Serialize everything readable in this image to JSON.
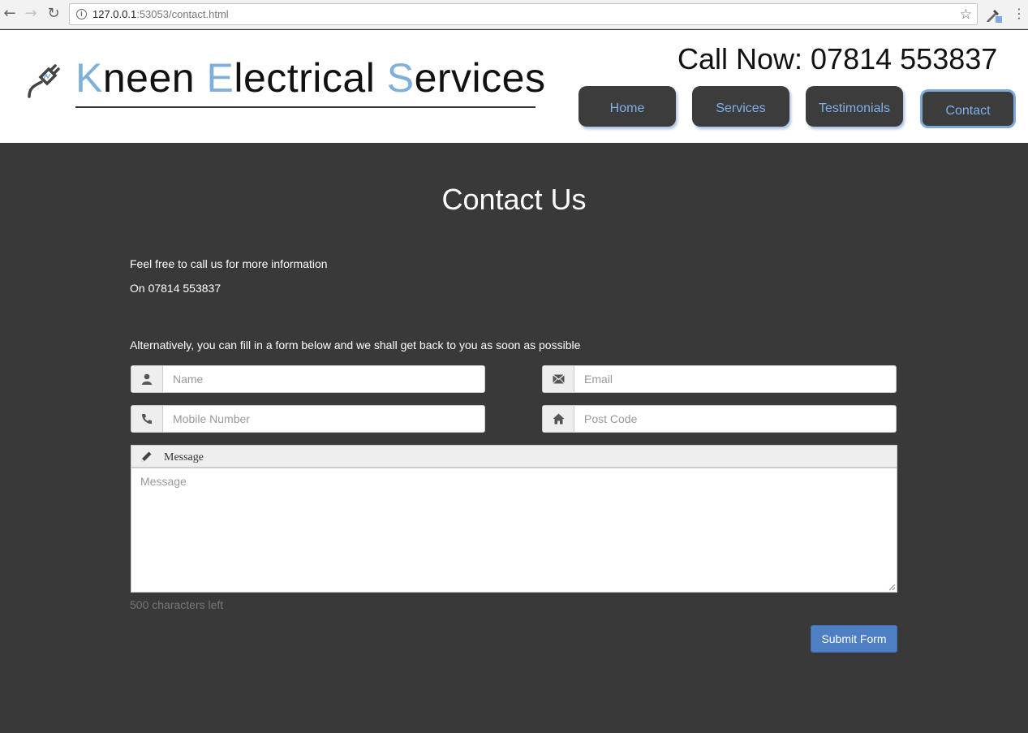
{
  "browser": {
    "url_host": "127.0.0.1",
    "url_rest": ":53053/contact.html"
  },
  "header": {
    "logo": {
      "word1_initial": "K",
      "word1_rest": "neen ",
      "word2_initial": "E",
      "word2_rest": "lectrical ",
      "word3_initial": "S",
      "word3_rest": "ervices"
    },
    "call_now": "Call Now: 07814 553837",
    "nav": [
      "Home",
      "Services",
      "Testimonials",
      "Contact"
    ],
    "active_nav": "Contact"
  },
  "main": {
    "title": "Contact Us",
    "line1": "Feel free to call us for more information",
    "line2": "On 07814 553837",
    "line3": "Alternatively, you can fill in a form below and we shall get back to you as soon as possible",
    "form": {
      "name_placeholder": "Name",
      "email_placeholder": "Email",
      "mobile_placeholder": "Mobile Number",
      "postcode_placeholder": "Post Code",
      "message_label": "Message",
      "message_placeholder": "Message",
      "chars_left": "500 characters left",
      "submit_label": "Submit Form"
    }
  },
  "colors": {
    "accent": "#7fb0dc",
    "background": "#393939",
    "nav_bg": "#3c3c3c",
    "submit": "#4d7fc2"
  }
}
